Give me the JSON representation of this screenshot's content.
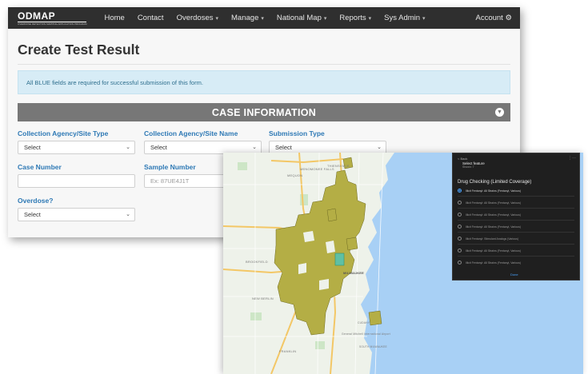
{
  "navbar": {
    "logo_wordmark": "ODMAP",
    "logo_tagline": "OVERDOSE DETECTION MAPPING APPLICATION PROGRAM",
    "items": [
      {
        "label": "Home",
        "has_caret": false
      },
      {
        "label": "Contact",
        "has_caret": false
      },
      {
        "label": "Overdoses",
        "has_caret": true
      },
      {
        "label": "Manage",
        "has_caret": true
      },
      {
        "label": "National Map",
        "has_caret": true
      },
      {
        "label": "Reports",
        "has_caret": true
      },
      {
        "label": "Sys Admin",
        "has_caret": true
      }
    ],
    "account_label": "Account",
    "account_icon": "gear-icon"
  },
  "page": {
    "title": "Create Test Result",
    "notice": "All BLUE fields are required for successful submission of this form."
  },
  "section": {
    "title": "CASE INFORMATION",
    "collapse_icon": "chevron-down-icon"
  },
  "form": {
    "collection_agency_type": {
      "label": "Collection Agency/Site Type",
      "value": "Select"
    },
    "collection_agency_name": {
      "label": "Collection Agency/Site Name",
      "value": "Select"
    },
    "submission_type": {
      "label": "Submission Type",
      "value": "Select"
    },
    "case_number": {
      "label": "Case Number",
      "value": "",
      "placeholder": ""
    },
    "sample_number": {
      "label": "Sample Number",
      "value": "",
      "placeholder": "Ex: 87UE4J1T"
    },
    "overdose": {
      "label": "Overdose?",
      "value": "Select"
    }
  },
  "map_panel": {
    "top_label": "< Back",
    "title": "Select feature",
    "subtitle": "Shown: 7",
    "heading": "Drug Checking (Limited Coverage)",
    "options": [
      {
        "label": "Illicit Fentanyl: All Strains (Fentanyl, Various)",
        "selected": true
      },
      {
        "label": "Illicit Fentanyl: All Strains (Fentanyl, Various)",
        "selected": false
      },
      {
        "label": "Illicit Fentanyl: All Strains (Fentanyl, Various)",
        "selected": false
      },
      {
        "label": "Illicit Fentanyl: All Strains (Fentanyl, Various)",
        "selected": false
      },
      {
        "label": "Illicit Fentanyl: Stimulant Analogs (Various)",
        "selected": false
      },
      {
        "label": "Illicit Fentanyl: All Strains (Fentanyl, Various)",
        "selected": false
      },
      {
        "label": "Illicit Fentanyl: All Strains (Fentanyl, Various)",
        "selected": false
      }
    ],
    "done_label": "Done"
  },
  "map_labels": {
    "menomonee": "MENOMONEE FALLS",
    "thiensville": "THIENSVILLE",
    "mequon": "MEQUON",
    "brookfield": "BROOKFIELD",
    "newberlin": "NEW BERLIN",
    "milwaukee": "MILWAUKEE",
    "franklin": "FRANKLIN",
    "airport": "General Mitchell International Airport",
    "south_milwaukee": "SOUTH MILWAUKEE",
    "cudahy": "CUDAHY"
  },
  "colors": {
    "navbar_bg": "#2f2f2f",
    "label_blue": "#2e79b5",
    "notice_bg": "#d7ecf6",
    "section_bar": "#777777",
    "lake": "#a8d0f5",
    "land": "#eef2ea",
    "overlay_fill": "#b4ae45",
    "highlight_fill": "#5fc0a4"
  }
}
